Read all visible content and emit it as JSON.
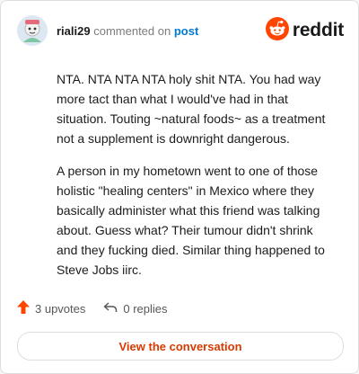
{
  "header": {
    "username": "riali29",
    "commented_on": "commented on",
    "post_link": "post",
    "brand": "reddit"
  },
  "comment": {
    "paragraphs": [
      "NTA. NTA NTA NTA holy shit NTA. You had way more tact than what I would've had in that situation. Touting ~natural foods~ as a treatment not a supplement is downright dangerous.",
      "A person in my hometown went to one of those holistic \"healing centers\" in Mexico where they basically administer what this friend was talking about. Guess what? Their tumour didn't shrink and they fucking died. Similar thing happened to Steve Jobs iirc."
    ]
  },
  "actions": {
    "upvotes": "3 upvotes",
    "replies": "0 replies"
  },
  "cta": {
    "label": "View the conversation"
  },
  "colors": {
    "brand_orange": "#ff4500",
    "link_blue": "#0079d3",
    "cta_text": "#d93a00"
  },
  "icons": [
    "avatar",
    "reddit-logo-icon",
    "upvote-arrow-icon",
    "reply-arrow-icon"
  ]
}
